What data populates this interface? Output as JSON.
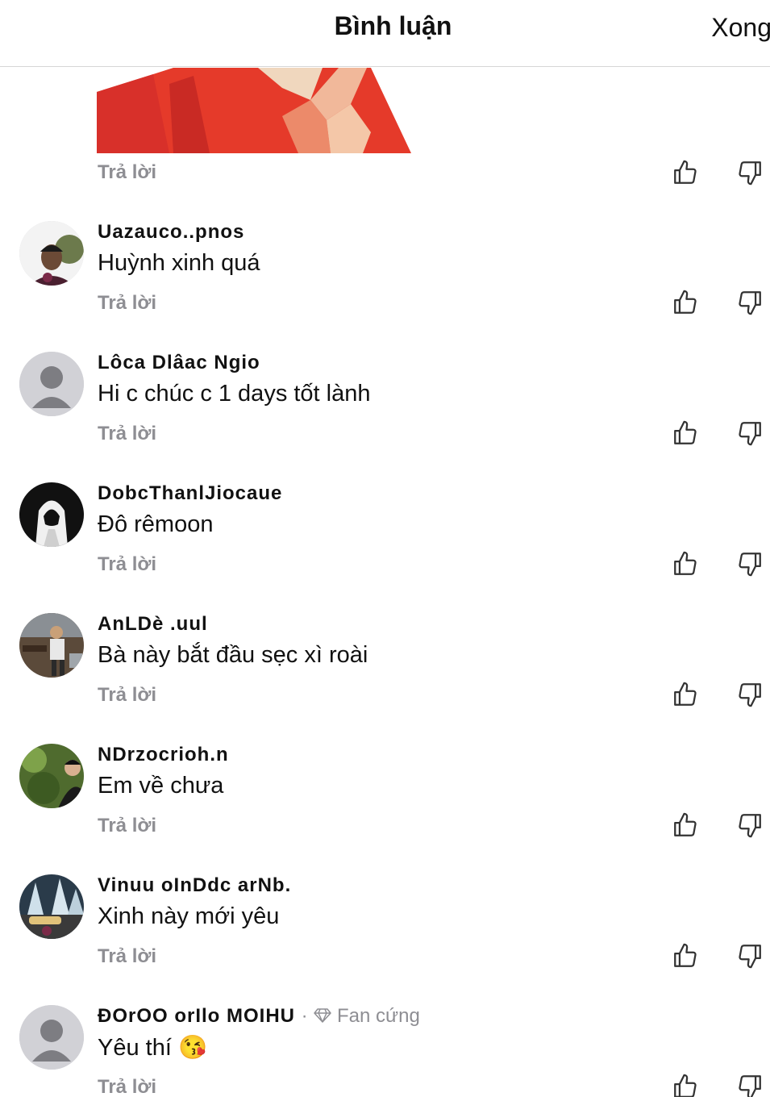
{
  "header": {
    "title": "Bình luận",
    "done_label": "Xong"
  },
  "top_reply_label": "Trả lời",
  "comments": [
    {
      "name": "Uazauco..pnos",
      "text": "Huỳnh xinh quá",
      "reply": "Trả lời",
      "avatar": "photo-man"
    },
    {
      "name": "Lôca Dlâac Ngio",
      "text": "Hi c chúc c 1 days tốt lành",
      "reply": "Trả lời",
      "avatar": "default-person"
    },
    {
      "name": "DobcThanlJiocaue",
      "text": "Đô rêmoon",
      "reply": "Trả lời",
      "avatar": "photo-hoodie"
    },
    {
      "name": "AnLDè .uul",
      "text": "Bà này bắt đầu sẹc xì roài",
      "reply": "Trả lời",
      "avatar": "photo-cafe"
    },
    {
      "name": "NDrzocrioh.n",
      "text": "Em về chưa",
      "reply": "Trả lời",
      "avatar": "photo-garden"
    },
    {
      "name": "Vinuu oInDdc arNb.",
      "text": "Xinh này mới yêu",
      "reply": "Trả lời",
      "avatar": "photo-night"
    },
    {
      "name": "ĐOrOO orIlo MOIHU",
      "badge": "Fan cứng",
      "separator": "·",
      "text": "Yêu thí",
      "emoji": "😘",
      "reply": "Trả lời",
      "avatar": "default-person"
    }
  ],
  "colors": {
    "reply_gray": "#8e8e93",
    "divider": "#d6d6d6",
    "text": "#111111",
    "image_red": "#e53a2a"
  }
}
